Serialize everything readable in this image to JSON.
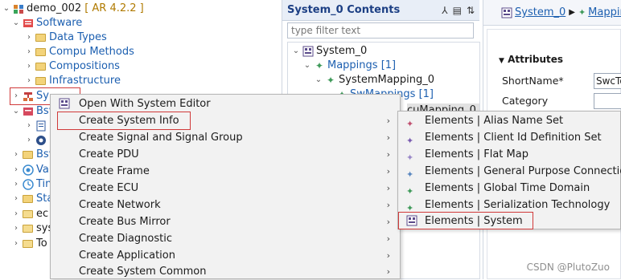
{
  "tree": {
    "root_label": "demo_002",
    "root_version": "[ AR 4.2.2 ]",
    "software_label": "Software",
    "software_children": [
      "Data Types",
      "Compu Methods",
      "Compositions",
      "Infrastructure"
    ],
    "system_label": "Sy",
    "bsw_label": "Bsv",
    "bsw2_label": "Bsv",
    "va_label": "Va",
    "tin_label": "Tin",
    "sta_label": "Sta",
    "ec_label": "ec",
    "sys_label": "sys",
    "to_label": "To"
  },
  "contents": {
    "title": "System_0 Contents",
    "filter_placeholder": "type filter text",
    "items": {
      "system": "System_0",
      "mappings": "Mappings [1]",
      "system_mapping": "SystemMapping_0",
      "sw_mappings": "SwMappings [1]",
      "ecu_mapping": "cuMapping_0"
    }
  },
  "editor": {
    "breadcrumb_1": "System_0",
    "breadcrumb_2": "Mapping",
    "section_title": "Attributes",
    "shortname_label": "ShortName*",
    "shortname_value": "SwcTo",
    "category_label": "Category"
  },
  "context_menu": {
    "items": [
      {
        "label": "Open With System Editor",
        "submenu": false
      },
      {
        "label": "Create System Info",
        "submenu": true
      },
      {
        "label": "Create Signal and Signal Group",
        "submenu": true
      },
      {
        "label": "Create PDU",
        "submenu": true
      },
      {
        "label": "Create Frame",
        "submenu": true
      },
      {
        "label": "Create ECU",
        "submenu": true
      },
      {
        "label": "Create Network",
        "submenu": true
      },
      {
        "label": "Create Bus Mirror",
        "submenu": true
      },
      {
        "label": "Create Diagnostic",
        "submenu": true
      },
      {
        "label": "Create Application",
        "submenu": true
      },
      {
        "label": "Create System Common",
        "submenu": true
      }
    ]
  },
  "submenu": {
    "items": [
      {
        "label": "Elements | Alias Name Set",
        "icon": "diamond-icon",
        "color": "#c05070"
      },
      {
        "label": "Elements | Client Id Definition Set",
        "icon": "diamond-icon",
        "color": "#7a5cb0"
      },
      {
        "label": "Elements | Flat Map",
        "icon": "diamond-icon",
        "color": "#9a88c8"
      },
      {
        "label": "Elements | General Purpose Connection",
        "icon": "diamond-icon",
        "color": "#5b88c0"
      },
      {
        "label": "Elements | Global Time Domain",
        "icon": "diamond-icon",
        "color": "#3f9a5a"
      },
      {
        "label": "Elements | Serialization Technology",
        "icon": "diamond-icon",
        "color": "#3f9a5a"
      },
      {
        "label": "Elements | System",
        "icon": "system-icon",
        "color": "#6a5a9a"
      }
    ]
  },
  "watermark": "CSDN @PlutoZuo",
  "colors": {
    "highlight_box": "#d03a3a",
    "link_blue": "#1c5fb0",
    "header_bg": "#e8eef7"
  }
}
